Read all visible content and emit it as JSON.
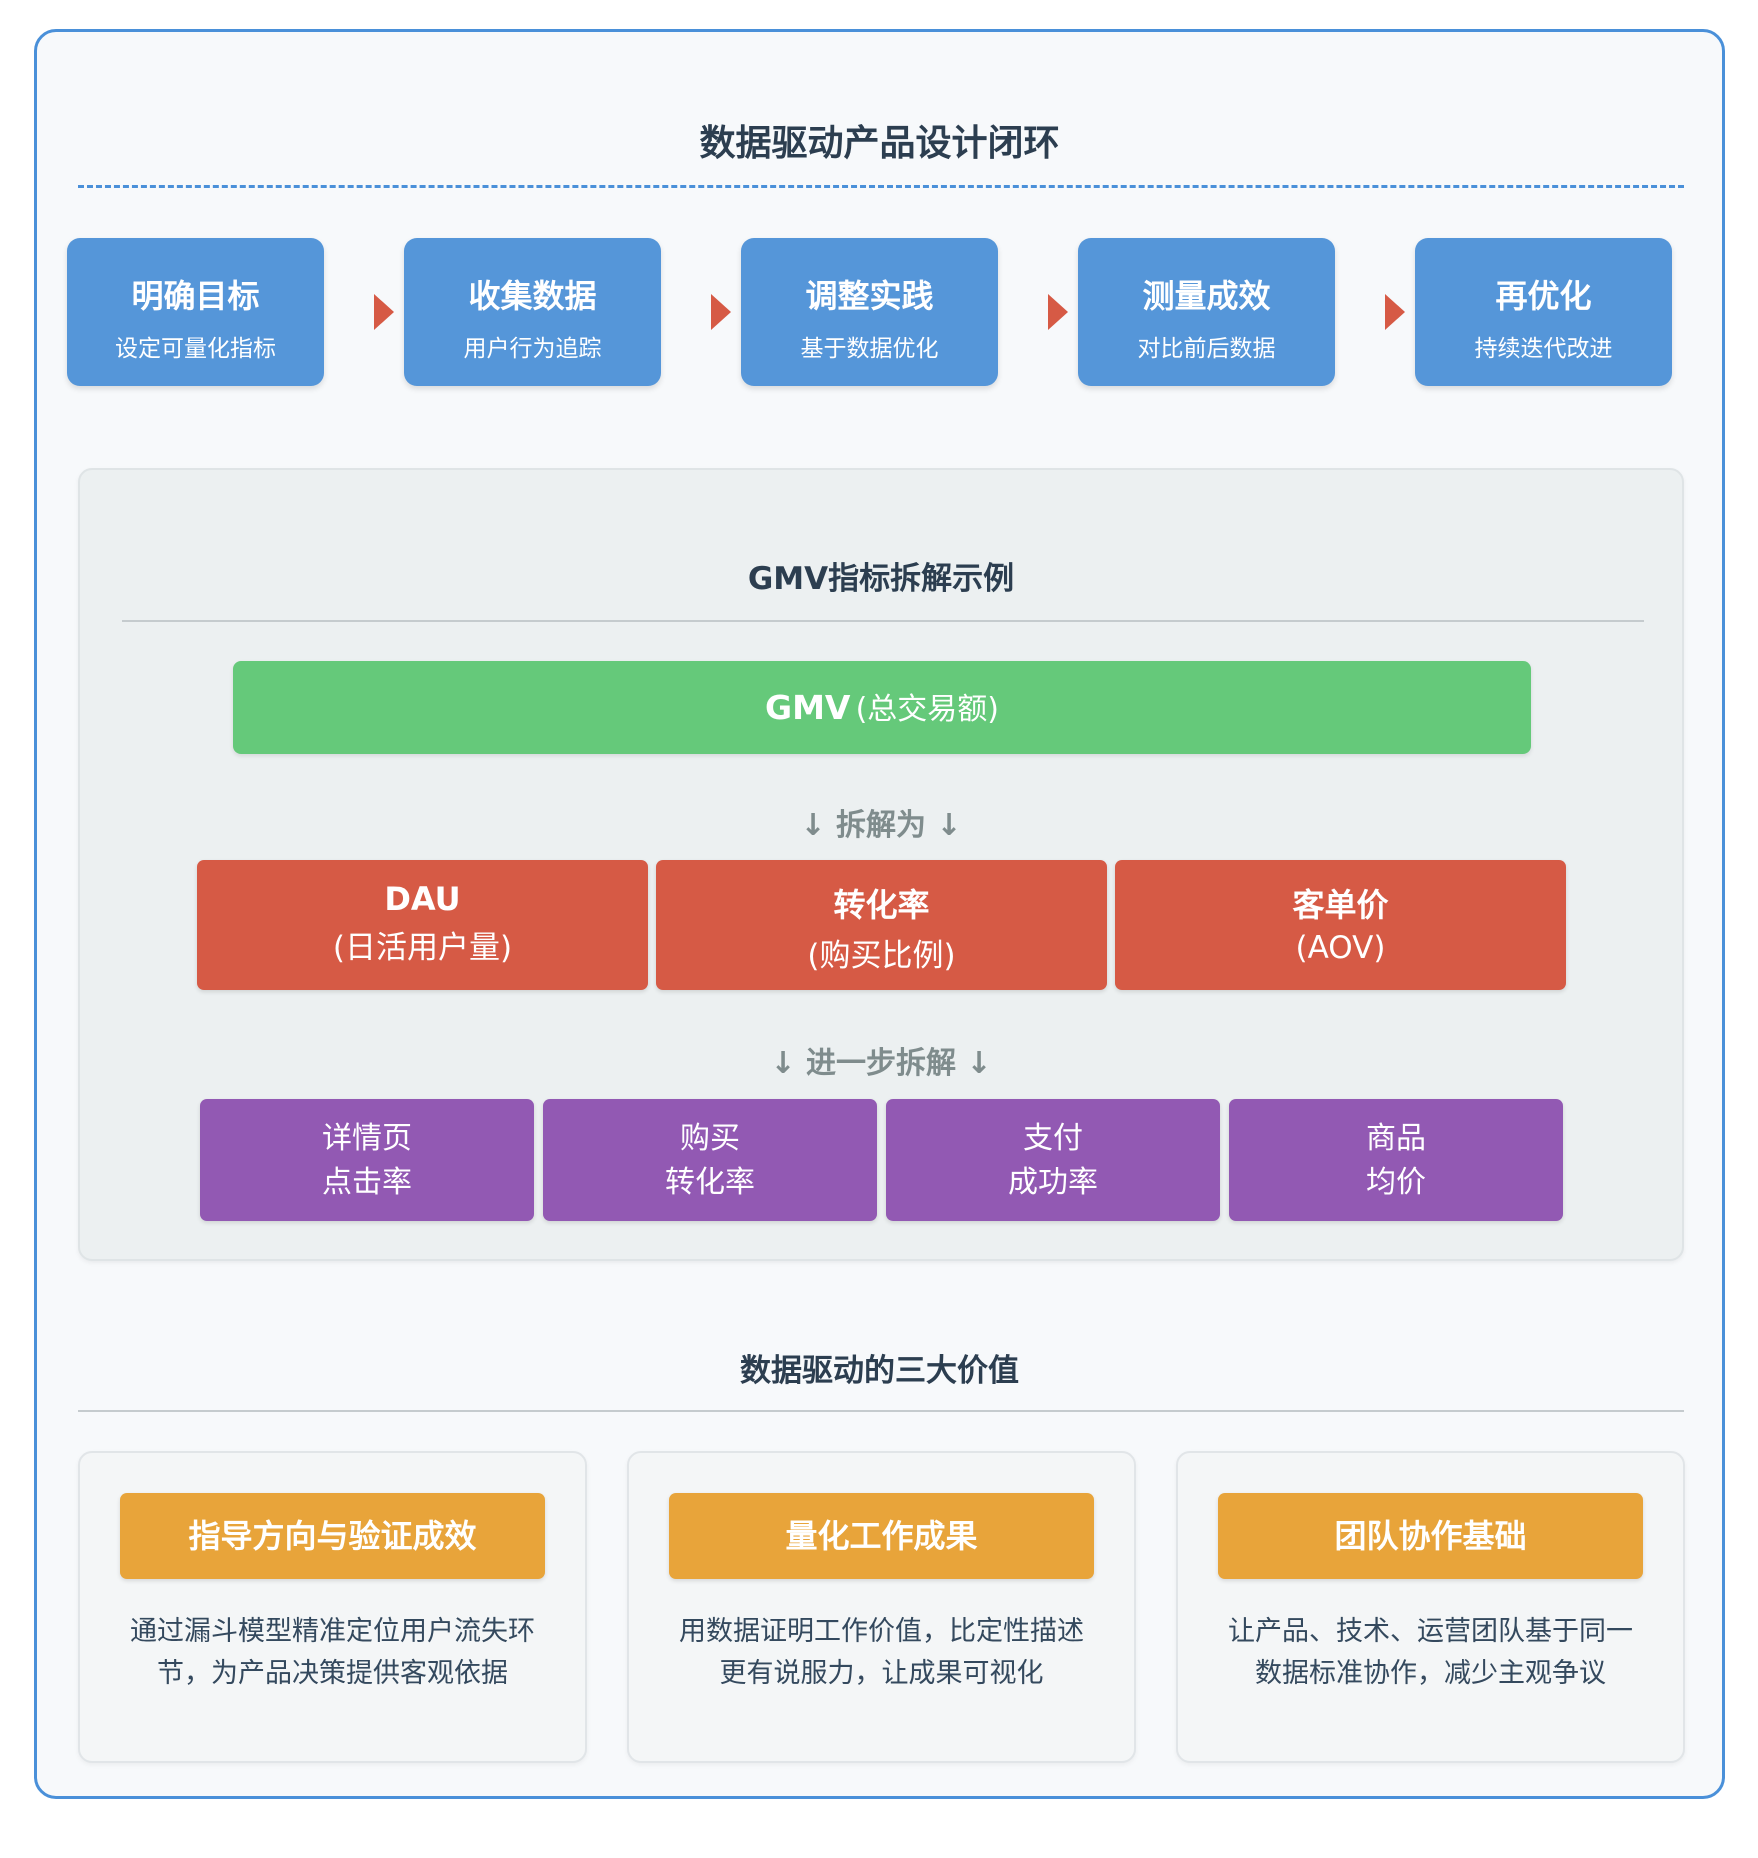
{
  "title": "数据驱动产品设计闭环",
  "steps": [
    {
      "title": "明确目标",
      "subtitle": "设定可量化指标"
    },
    {
      "title": "收集数据",
      "subtitle": "用户行为追踪"
    },
    {
      "title": "调整实践",
      "subtitle": "基于数据优化"
    },
    {
      "title": "测量成效",
      "subtitle": "对比前后数据"
    },
    {
      "title": "再优化",
      "subtitle": "持续迭代改进"
    }
  ],
  "gmv": {
    "title": "GMV指标拆解示例",
    "root": {
      "main": "GMV",
      "sub": "(总交易额)"
    },
    "split_label": "↓ 拆解为 ↓",
    "metrics": [
      {
        "title": "DAU",
        "subtitle": "(日活用户量)"
      },
      {
        "title": "转化率",
        "subtitle": "(购买比例)"
      },
      {
        "title": "客单价",
        "subtitle": "(AOV)"
      }
    ],
    "further_label": "↓ 进一步拆解 ↓",
    "sub_metrics": [
      {
        "line1": "详情页",
        "line2": "点击率"
      },
      {
        "line1": "购买",
        "line2": "转化率"
      },
      {
        "line1": "支付",
        "line2": "成功率"
      },
      {
        "line1": "商品",
        "line2": "均价"
      }
    ]
  },
  "values": {
    "title": "数据驱动的三大价值",
    "cards": [
      {
        "badge": "指导方向与验证成效",
        "line1": "通过漏斗模型精准定位用户流失环",
        "line2": "节，为产品决策提供客观依据"
      },
      {
        "badge": "量化工作成果",
        "line1": "用数据证明工作价值，比定性描述",
        "line2": "更有说服力，让成果可视化"
      },
      {
        "badge": "团队协作基础",
        "line1": "让产品、技术、运营团队基于同一",
        "line2": "数据标准协作，减少主观争议"
      }
    ]
  },
  "colors": {
    "frame_border": "#4a90d9",
    "step": "#5596d9",
    "arrow": "#d65a45",
    "gmv_root": "#65c97a",
    "metric": "#d65a45",
    "sub_metric": "#9259b3",
    "badge": "#e8a43a"
  }
}
